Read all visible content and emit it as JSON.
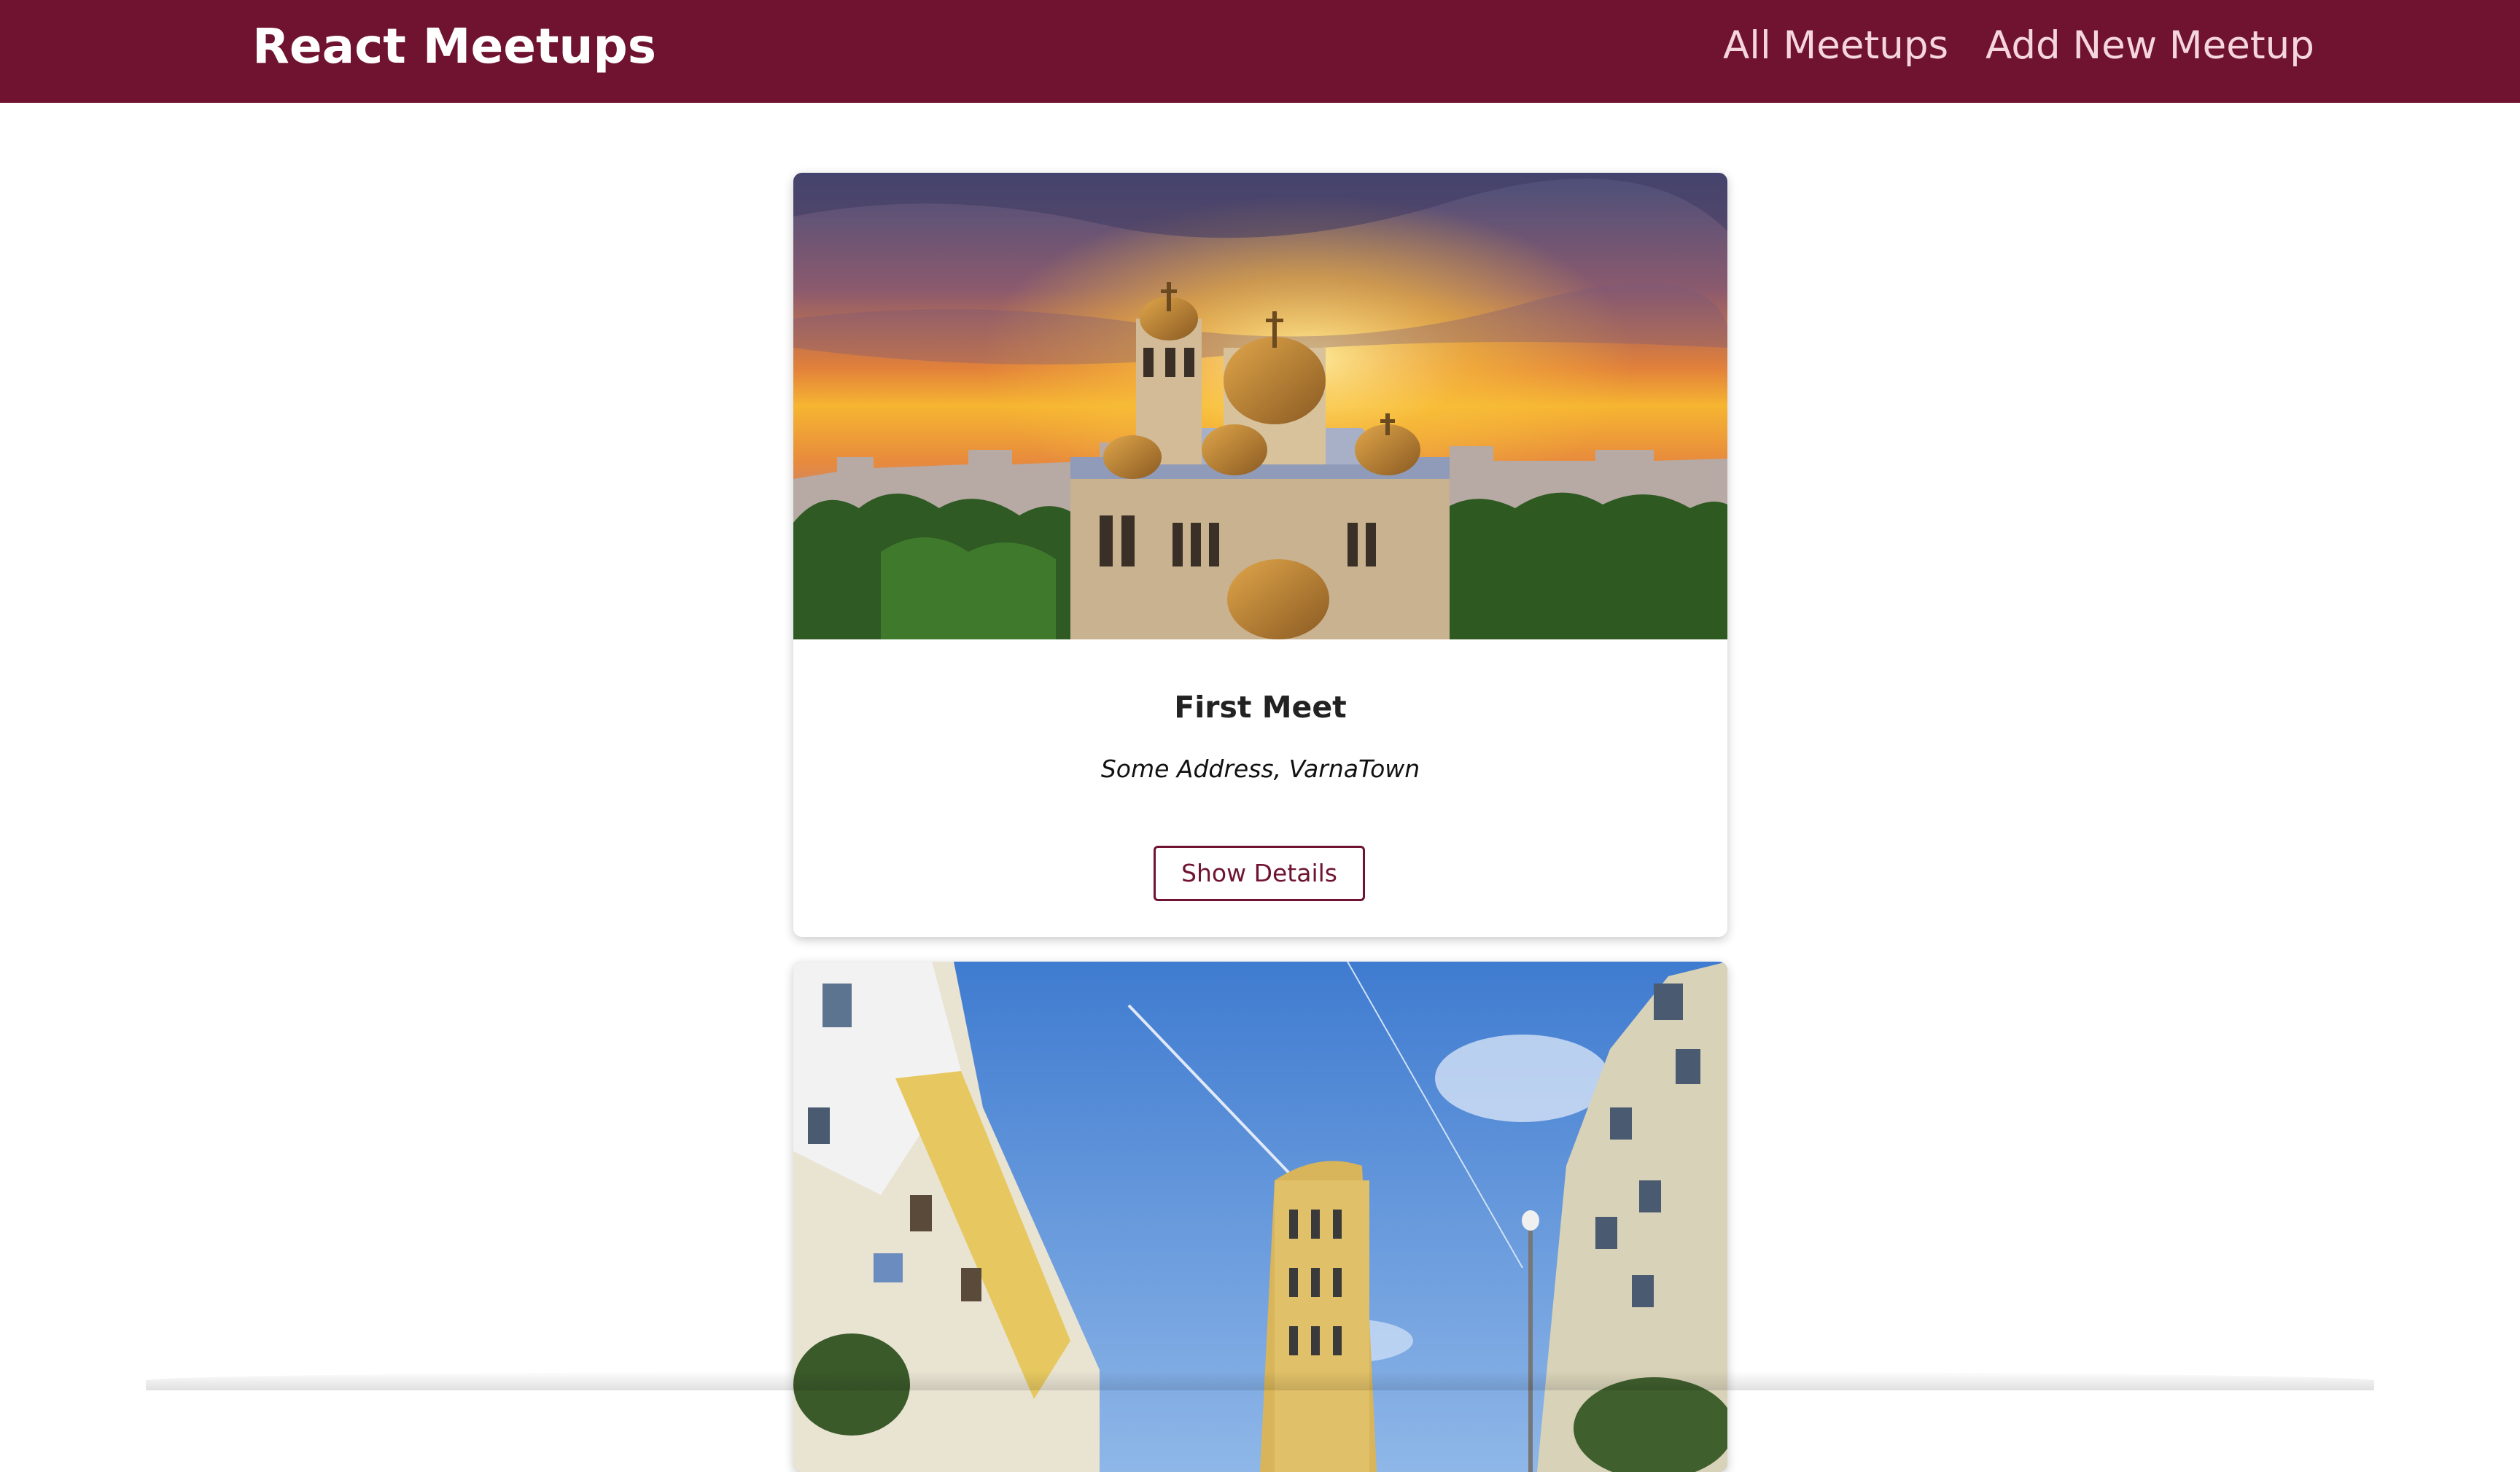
{
  "header": {
    "logo": "React Meetups",
    "nav": [
      {
        "label": "All Meetups"
      },
      {
        "label": "Add New Meetup"
      }
    ],
    "background_color": "#6f1330"
  },
  "meetups": [
    {
      "title": "First Meet",
      "address": "Some Address, VarnaTown",
      "button_label": "Show Details",
      "image": "cathedral-sunset-photo"
    },
    {
      "image": "city-street-buildings-photo"
    }
  ],
  "colors": {
    "accent": "#6f1330",
    "nav_text": "#f5d6df",
    "page_bg": "#ffffff"
  }
}
